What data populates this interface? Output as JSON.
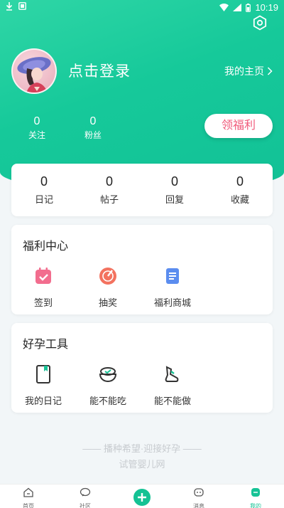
{
  "status_bar": {
    "time": "10:19"
  },
  "profile": {
    "login_text": "点击登录",
    "homepage_link": "我的主页"
  },
  "top_stats": [
    {
      "value": "0",
      "label": "关注"
    },
    {
      "value": "0",
      "label": "粉丝"
    }
  ],
  "welfare_button": "领福利",
  "counts": [
    {
      "value": "0",
      "label": "日记"
    },
    {
      "value": "0",
      "label": "帖子"
    },
    {
      "value": "0",
      "label": "回复"
    },
    {
      "value": "0",
      "label": "收藏"
    }
  ],
  "welfare_center": {
    "title": "福利中心",
    "items": [
      {
        "label": "签到",
        "icon": "calendar-check-icon"
      },
      {
        "label": "抽奖",
        "icon": "lottery-wheel-icon"
      },
      {
        "label": "福利商城",
        "icon": "mall-document-icon"
      }
    ]
  },
  "tools": {
    "title": "好孕工具",
    "items": [
      {
        "label": "我的日记",
        "icon": "diary-book-icon"
      },
      {
        "label": "能不能吃",
        "icon": "food-bowl-icon"
      },
      {
        "label": "能不能做",
        "icon": "activity-shoe-icon"
      }
    ]
  },
  "slogan": {
    "line1": "播种希望·迎接好孕",
    "line2": "试管婴儿网"
  },
  "tab_bar": {
    "items": [
      {
        "label": "首页",
        "icon": "home-icon"
      },
      {
        "label": "社区",
        "icon": "community-icon"
      },
      {
        "label": "",
        "icon": "plus-icon"
      },
      {
        "label": "消息",
        "icon": "message-icon"
      },
      {
        "label": "我的",
        "icon": "profile-icon"
      }
    ],
    "active": "我的"
  },
  "colors": {
    "brand_green": "#17c396",
    "welfare_pink": "#f05a7a",
    "background": "#f2f6f8"
  }
}
